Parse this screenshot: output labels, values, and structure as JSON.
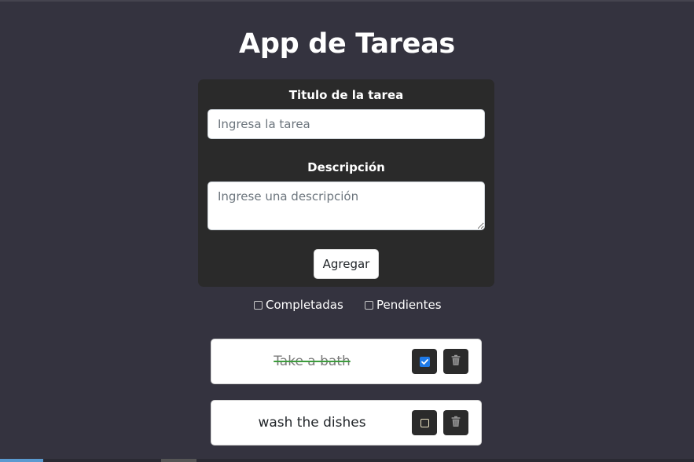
{
  "app": {
    "title": "App de Tareas"
  },
  "form": {
    "title_label": "Titulo de la tarea",
    "title_placeholder": "Ingresa la tarea",
    "title_value": "",
    "description_label": "Descripción",
    "description_placeholder": "Ingrese una descripción",
    "description_value": "",
    "add_button_label": "Agregar"
  },
  "filters": {
    "completed_label": "Completadas",
    "completed_checked": false,
    "pending_label": "Pendientes",
    "pending_checked": false
  },
  "tasks": [
    {
      "title": "Take a bath",
      "completed": true
    },
    {
      "title": "wash the dishes",
      "completed": false
    }
  ],
  "icons": {
    "toggle_checked": "checkbox-checked-icon",
    "toggle_unchecked": "checkbox-unchecked-icon",
    "delete": "trash-icon"
  },
  "colors": {
    "background": "#34333f",
    "form_card": "#2a2a2a",
    "task_card": "#ffffff",
    "icon_button": "#2b2b2b",
    "checked_accent": "#1e7ae8",
    "strike_color": "#3c9c3c"
  }
}
